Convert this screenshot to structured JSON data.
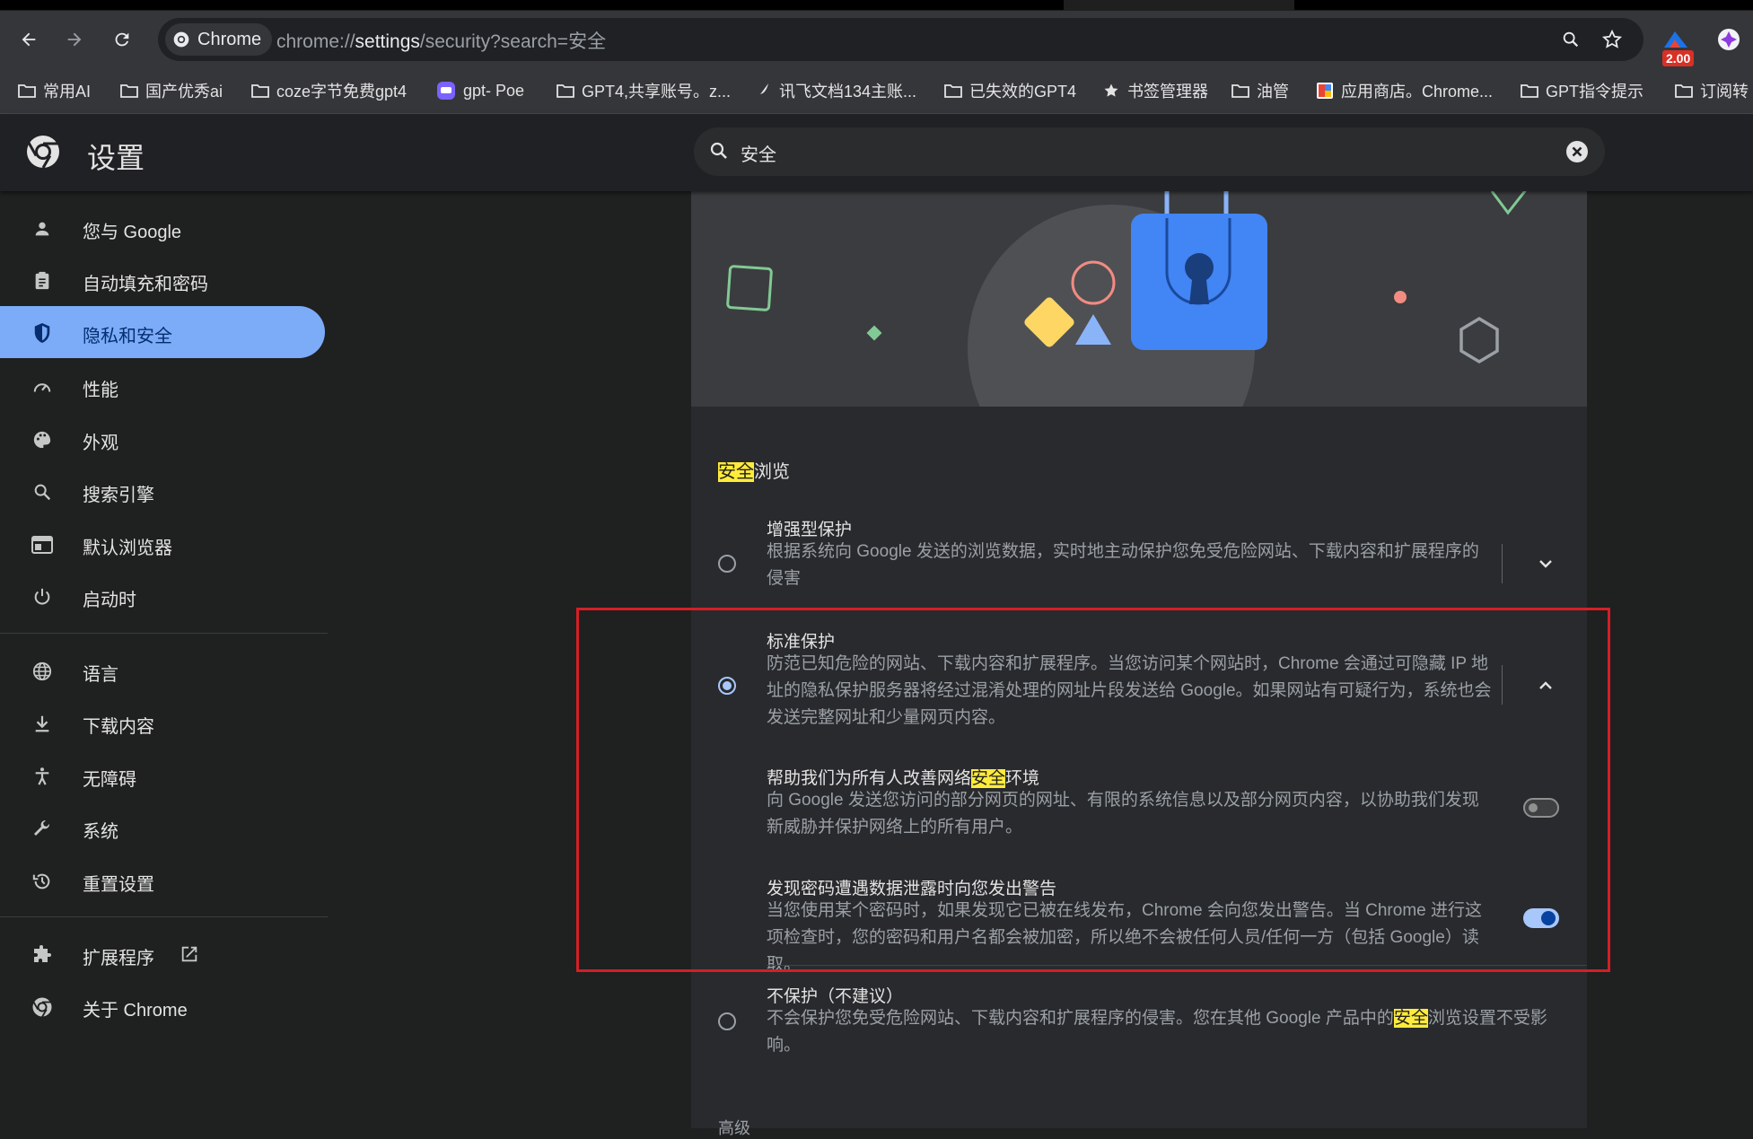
{
  "browser": {
    "omnibox": {
      "chip_label": "Chrome",
      "url_prefix": "chrome://",
      "url_host": "settings",
      "url_rest": "/security?search=安全"
    },
    "extension_badge": "2.00",
    "bookmarks": [
      {
        "label": "常用AI",
        "icon": "folder-icon"
      },
      {
        "label": "国产优秀ai",
        "icon": "folder-icon"
      },
      {
        "label": "coze字节免费gpt4",
        "icon": "folder-icon"
      },
      {
        "label": "gpt- Poe",
        "icon": "poe-icon"
      },
      {
        "label": "GPT4,共享账号。z...",
        "icon": "folder-icon"
      },
      {
        "label": "讯飞文档134主账...",
        "icon": "feather-icon"
      },
      {
        "label": "已失效的GPT4",
        "icon": "folder-icon"
      },
      {
        "label": "书签管理器",
        "icon": "star-icon"
      },
      {
        "label": "油管",
        "icon": "folder-icon"
      },
      {
        "label": "应用商店。Chrome...",
        "icon": "store-icon"
      },
      {
        "label": "GPT指令提示",
        "icon": "folder-icon"
      },
      {
        "label": "订阅转",
        "icon": "folder-icon"
      }
    ]
  },
  "header": {
    "title": "设置",
    "search_value": "安全"
  },
  "sidebar": {
    "items": [
      {
        "label": "您与 Google",
        "icon": "person-icon"
      },
      {
        "label": "自动填充和密码",
        "icon": "clipboard-icon"
      },
      {
        "label": "隐私和安全",
        "icon": "shield-icon"
      },
      {
        "label": "性能",
        "icon": "speedometer-icon"
      },
      {
        "label": "外观",
        "icon": "palette-icon"
      },
      {
        "label": "搜索引擎",
        "icon": "search-icon"
      },
      {
        "label": "默认浏览器",
        "icon": "browser-icon"
      },
      {
        "label": "启动时",
        "icon": "power-icon"
      },
      {
        "label": "语言",
        "icon": "globe-icon"
      },
      {
        "label": "下载内容",
        "icon": "download-icon"
      },
      {
        "label": "无障碍",
        "icon": "accessibility-icon"
      },
      {
        "label": "系统",
        "icon": "wrench-icon"
      },
      {
        "label": "重置设置",
        "icon": "history-icon"
      },
      {
        "label": "扩展程序",
        "icon": "puzzle-icon"
      },
      {
        "label": "关于 Chrome",
        "icon": "chrome-icon"
      }
    ],
    "active_index": 2
  },
  "main": {
    "section_highlight": "安全",
    "section_rest": "浏览",
    "enhanced": {
      "title": "增强型保护",
      "desc": "根据系统向 Google 发送的浏览数据，实时地主动保护您免受危险网站、下载内容和扩展程序的侵害"
    },
    "standard": {
      "title": "标准保护",
      "desc": "防范已知危险的网站、下载内容和扩展程序。当您访问某个网站时，Chrome 会通过可隐藏 IP 地址的隐私保护服务器将经过混淆处理的网址片段发送给 Google。如果网站有可疑行为，系统也会发送完整网址和少量网页内容。",
      "sub1_title_pre": "帮助我们为所有人改善网络",
      "sub1_title_hl": "安全",
      "sub1_title_post": "环境",
      "sub1_desc": "向 Google 发送您访问的部分网页的网址、有限的系统信息以及部分网页内容，以协助我们发现新威胁并保护网络上的所有用户。",
      "sub1_enabled": false,
      "sub2_title": "发现密码遭遇数据泄露时向您发出警告",
      "sub2_desc": "当您使用某个密码时，如果发现它已被在线发布，Chrome 会向您发出警告。当 Chrome 进行这项检查时，您的密码和用户名都会被加密，所以绝不会被任何人员/任何一方（包括 Google）读取。",
      "sub2_enabled": true
    },
    "none": {
      "title": "不保护（不建议）",
      "desc_pre": "不会保护您免受危险网站、下载内容和扩展程序的侵害。您在其他 Google 产品中的",
      "desc_hl": "安全",
      "desc_post": "浏览设置不受影响。"
    },
    "selected": "standard",
    "more_label": "高级"
  },
  "colors": {
    "accent": "#7cacf8",
    "highlight": "#ffeb3b",
    "annotation": "#d41f26"
  }
}
